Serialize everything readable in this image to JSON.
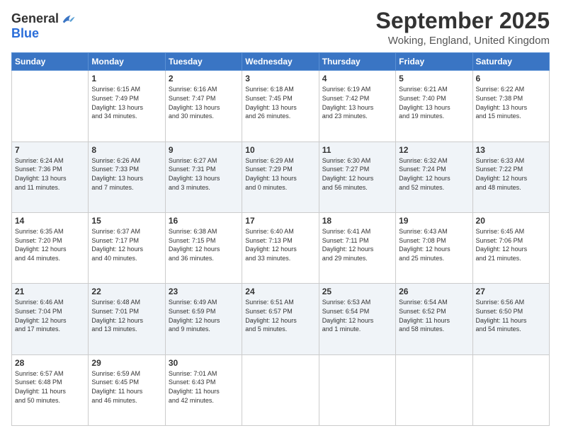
{
  "header": {
    "logo_general": "General",
    "logo_blue": "Blue",
    "month_title": "September 2025",
    "location": "Woking, England, United Kingdom"
  },
  "days_of_week": [
    "Sunday",
    "Monday",
    "Tuesday",
    "Wednesday",
    "Thursday",
    "Friday",
    "Saturday"
  ],
  "weeks": [
    [
      {
        "day": "",
        "info": ""
      },
      {
        "day": "1",
        "info": "Sunrise: 6:15 AM\nSunset: 7:49 PM\nDaylight: 13 hours\nand 34 minutes."
      },
      {
        "day": "2",
        "info": "Sunrise: 6:16 AM\nSunset: 7:47 PM\nDaylight: 13 hours\nand 30 minutes."
      },
      {
        "day": "3",
        "info": "Sunrise: 6:18 AM\nSunset: 7:45 PM\nDaylight: 13 hours\nand 26 minutes."
      },
      {
        "day": "4",
        "info": "Sunrise: 6:19 AM\nSunset: 7:42 PM\nDaylight: 13 hours\nand 23 minutes."
      },
      {
        "day": "5",
        "info": "Sunrise: 6:21 AM\nSunset: 7:40 PM\nDaylight: 13 hours\nand 19 minutes."
      },
      {
        "day": "6",
        "info": "Sunrise: 6:22 AM\nSunset: 7:38 PM\nDaylight: 13 hours\nand 15 minutes."
      }
    ],
    [
      {
        "day": "7",
        "info": "Sunrise: 6:24 AM\nSunset: 7:36 PM\nDaylight: 13 hours\nand 11 minutes."
      },
      {
        "day": "8",
        "info": "Sunrise: 6:26 AM\nSunset: 7:33 PM\nDaylight: 13 hours\nand 7 minutes."
      },
      {
        "day": "9",
        "info": "Sunrise: 6:27 AM\nSunset: 7:31 PM\nDaylight: 13 hours\nand 3 minutes."
      },
      {
        "day": "10",
        "info": "Sunrise: 6:29 AM\nSunset: 7:29 PM\nDaylight: 13 hours\nand 0 minutes."
      },
      {
        "day": "11",
        "info": "Sunrise: 6:30 AM\nSunset: 7:27 PM\nDaylight: 12 hours\nand 56 minutes."
      },
      {
        "day": "12",
        "info": "Sunrise: 6:32 AM\nSunset: 7:24 PM\nDaylight: 12 hours\nand 52 minutes."
      },
      {
        "day": "13",
        "info": "Sunrise: 6:33 AM\nSunset: 7:22 PM\nDaylight: 12 hours\nand 48 minutes."
      }
    ],
    [
      {
        "day": "14",
        "info": "Sunrise: 6:35 AM\nSunset: 7:20 PM\nDaylight: 12 hours\nand 44 minutes."
      },
      {
        "day": "15",
        "info": "Sunrise: 6:37 AM\nSunset: 7:17 PM\nDaylight: 12 hours\nand 40 minutes."
      },
      {
        "day": "16",
        "info": "Sunrise: 6:38 AM\nSunset: 7:15 PM\nDaylight: 12 hours\nand 36 minutes."
      },
      {
        "day": "17",
        "info": "Sunrise: 6:40 AM\nSunset: 7:13 PM\nDaylight: 12 hours\nand 33 minutes."
      },
      {
        "day": "18",
        "info": "Sunrise: 6:41 AM\nSunset: 7:11 PM\nDaylight: 12 hours\nand 29 minutes."
      },
      {
        "day": "19",
        "info": "Sunrise: 6:43 AM\nSunset: 7:08 PM\nDaylight: 12 hours\nand 25 minutes."
      },
      {
        "day": "20",
        "info": "Sunrise: 6:45 AM\nSunset: 7:06 PM\nDaylight: 12 hours\nand 21 minutes."
      }
    ],
    [
      {
        "day": "21",
        "info": "Sunrise: 6:46 AM\nSunset: 7:04 PM\nDaylight: 12 hours\nand 17 minutes."
      },
      {
        "day": "22",
        "info": "Sunrise: 6:48 AM\nSunset: 7:01 PM\nDaylight: 12 hours\nand 13 minutes."
      },
      {
        "day": "23",
        "info": "Sunrise: 6:49 AM\nSunset: 6:59 PM\nDaylight: 12 hours\nand 9 minutes."
      },
      {
        "day": "24",
        "info": "Sunrise: 6:51 AM\nSunset: 6:57 PM\nDaylight: 12 hours\nand 5 minutes."
      },
      {
        "day": "25",
        "info": "Sunrise: 6:53 AM\nSunset: 6:54 PM\nDaylight: 12 hours\nand 1 minute."
      },
      {
        "day": "26",
        "info": "Sunrise: 6:54 AM\nSunset: 6:52 PM\nDaylight: 11 hours\nand 58 minutes."
      },
      {
        "day": "27",
        "info": "Sunrise: 6:56 AM\nSunset: 6:50 PM\nDaylight: 11 hours\nand 54 minutes."
      }
    ],
    [
      {
        "day": "28",
        "info": "Sunrise: 6:57 AM\nSunset: 6:48 PM\nDaylight: 11 hours\nand 50 minutes."
      },
      {
        "day": "29",
        "info": "Sunrise: 6:59 AM\nSunset: 6:45 PM\nDaylight: 11 hours\nand 46 minutes."
      },
      {
        "day": "30",
        "info": "Sunrise: 7:01 AM\nSunset: 6:43 PM\nDaylight: 11 hours\nand 42 minutes."
      },
      {
        "day": "",
        "info": ""
      },
      {
        "day": "",
        "info": ""
      },
      {
        "day": "",
        "info": ""
      },
      {
        "day": "",
        "info": ""
      }
    ]
  ]
}
